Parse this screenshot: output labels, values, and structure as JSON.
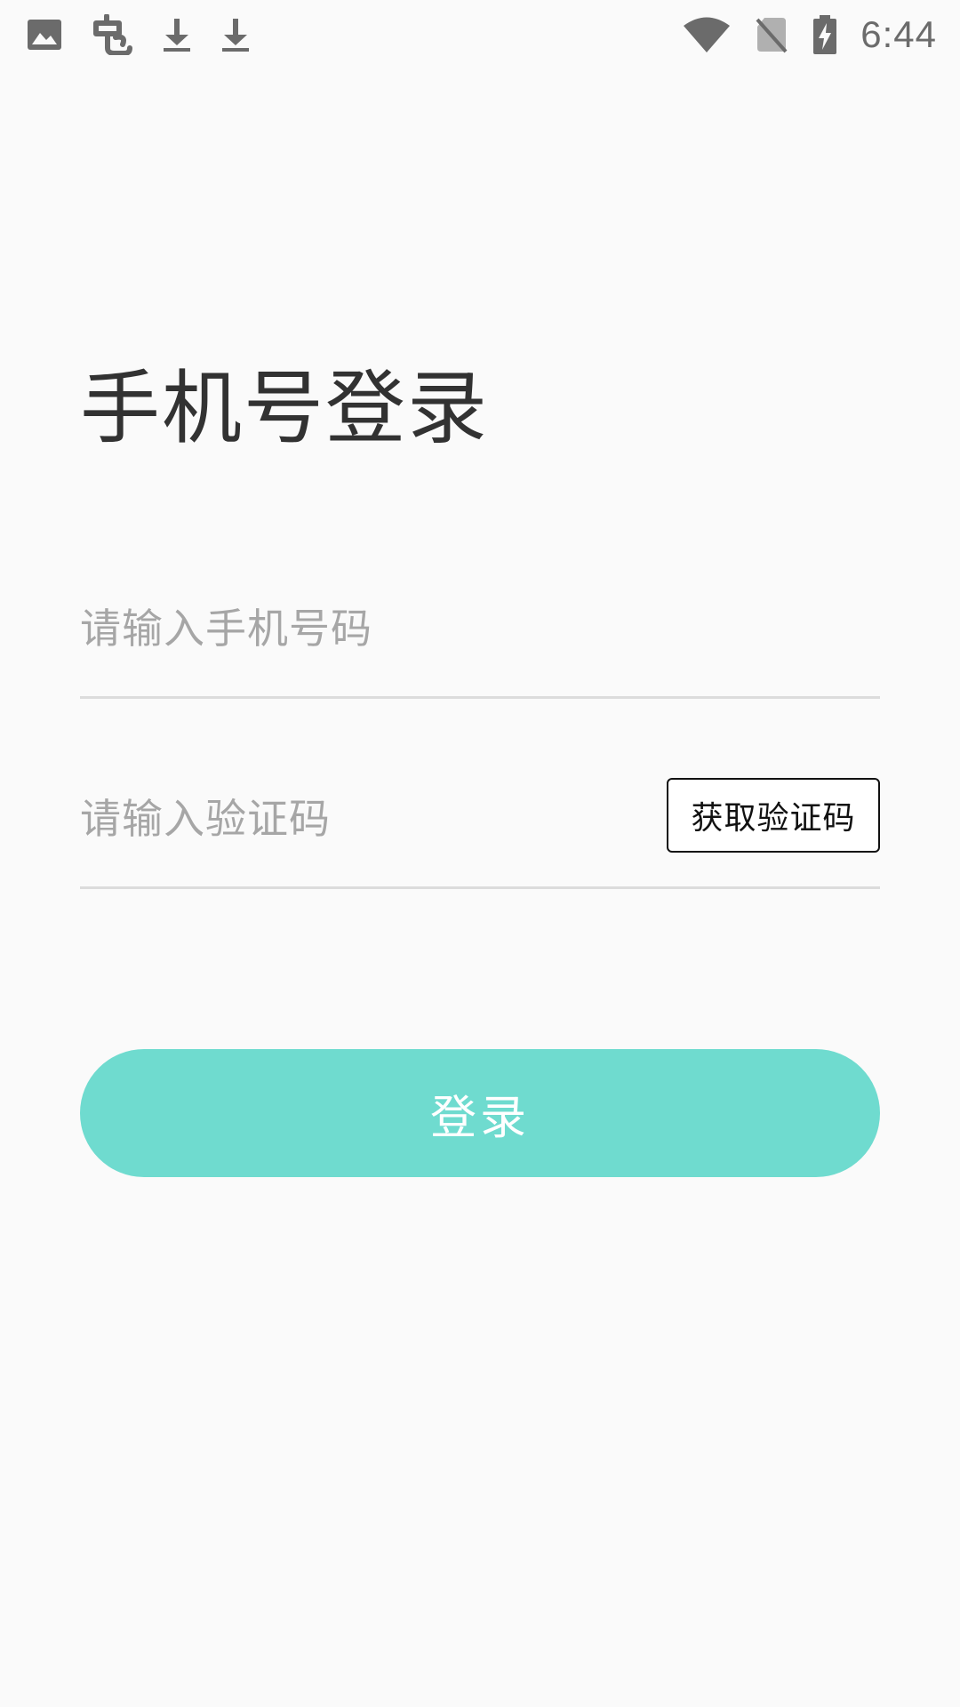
{
  "status_bar": {
    "left_icons": [
      "image-icon",
      "app-notification-icon",
      "download-icon",
      "download-icon"
    ],
    "right_icons": [
      "wifi-icon",
      "no-sim-icon",
      "battery-charging-icon"
    ],
    "time": "6:44",
    "icon_color": "#6b6b6b"
  },
  "page": {
    "title": "手机号登录",
    "background": "#fafafa"
  },
  "form": {
    "phone": {
      "placeholder": "请输入手机号码",
      "value": ""
    },
    "code": {
      "placeholder": "请输入验证码",
      "value": "",
      "button_label": "获取验证码"
    },
    "submit": {
      "label": "登录",
      "color": "#6fdbcf"
    }
  }
}
